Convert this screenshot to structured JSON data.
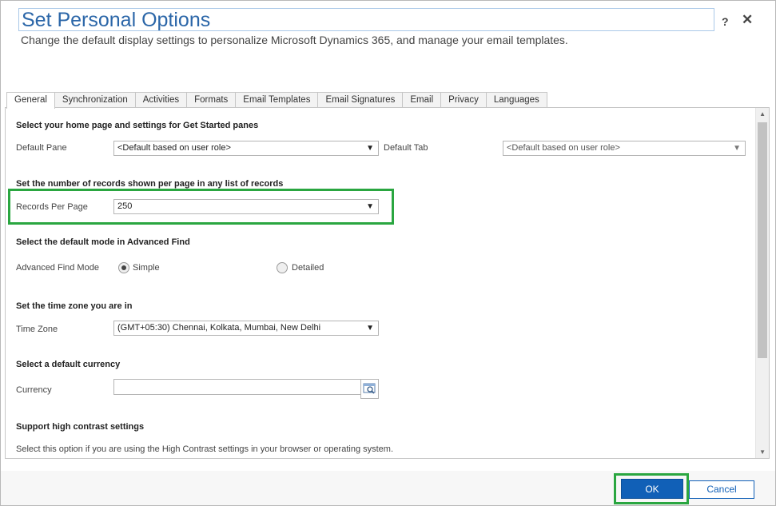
{
  "dialog": {
    "title": "Set Personal Options",
    "subtitle": "Change the default display settings to personalize Microsoft Dynamics 365, and manage your email templates.",
    "help_glyph": "?",
    "close_glyph": "✕"
  },
  "tabs": [
    {
      "label": "General",
      "active": true
    },
    {
      "label": "Synchronization"
    },
    {
      "label": "Activities"
    },
    {
      "label": "Formats"
    },
    {
      "label": "Email Templates"
    },
    {
      "label": "Email Signatures"
    },
    {
      "label": "Email"
    },
    {
      "label": "Privacy"
    },
    {
      "label": "Languages"
    }
  ],
  "general": {
    "home": {
      "heading": "Select your home page and settings for Get Started panes",
      "default_pane_label": "Default Pane",
      "default_pane_value": "<Default based on user role>",
      "default_tab_label": "Default Tab",
      "default_tab_value": "<Default based on user role>"
    },
    "records": {
      "heading": "Set the number of records shown per page in any list of records",
      "label": "Records Per Page",
      "value": "250"
    },
    "advanced_find": {
      "heading": "Select the default mode in Advanced Find",
      "label": "Advanced Find Mode",
      "simple_label": "Simple",
      "detailed_label": "Detailed",
      "selected": "Simple"
    },
    "timezone": {
      "heading": "Set the time zone you are in",
      "label": "Time Zone",
      "value": "(GMT+05:30) Chennai, Kolkata, Mumbai, New Delhi"
    },
    "currency": {
      "heading": "Select a default currency",
      "label": "Currency",
      "value": ""
    },
    "contrast": {
      "heading": "Support high contrast settings",
      "description": "Select this option if you are using the High Contrast settings in your browser or operating system."
    }
  },
  "footer": {
    "ok_label": "OK",
    "cancel_label": "Cancel"
  },
  "colors": {
    "title": "#2b66a8",
    "ok_button": "#1160b7",
    "highlight": "#2aa640"
  },
  "icons": {
    "dropdown": "▼",
    "scroll_up": "▲",
    "scroll_down": "▼"
  }
}
